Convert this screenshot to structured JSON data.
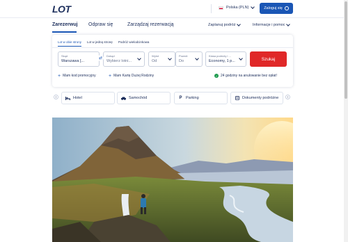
{
  "header": {
    "logo": "LOT",
    "country_label": "Polska (PLN)",
    "login_label": "Zaloguj się"
  },
  "nav": {
    "items": [
      {
        "label": "Zarezerwuj"
      },
      {
        "label": "Odpraw się"
      },
      {
        "label": "Zarządzaj rezerwacją"
      }
    ],
    "right_items": [
      {
        "label": "Zaplanuj podróż"
      },
      {
        "label": "Informacje i pomoc"
      }
    ]
  },
  "booking": {
    "tabs": [
      {
        "label": "Lot w obie strony"
      },
      {
        "label": "Lot w jedną stronę"
      },
      {
        "label": "Podróż wielodcinkowa"
      }
    ],
    "fields": {
      "from": {
        "label": "Skąd",
        "value": "Warszawa [..."
      },
      "to": {
        "label": "Dokąd",
        "value": "Wybierz lotni..."
      },
      "depart": {
        "label": "Wylot",
        "value": "Od"
      },
      "return": {
        "label": "Powrót",
        "value": "Do"
      },
      "cabin": {
        "label": "Klasa podróży i ...",
        "value": "Economy, 1 p..."
      }
    },
    "search_label": "Szukaj",
    "promo_label": "Mam kod promocyjny",
    "family_label": "Mam Kartę Dużej Rodziny",
    "cancel_label": "24 godziny na anulowanie bez opłat!"
  },
  "services": [
    {
      "label": "Hotel",
      "icon": "bed-icon"
    },
    {
      "label": "Samochód",
      "icon": "car-icon"
    },
    {
      "label": "Parking",
      "icon": "parking-icon"
    },
    {
      "label": "Dokumenty podróżne",
      "icon": "document-icon"
    }
  ],
  "colors": {
    "primary": "#1a56b5",
    "navy": "#1b2d5b",
    "search": "#e02828",
    "success": "#1e9b4e"
  }
}
